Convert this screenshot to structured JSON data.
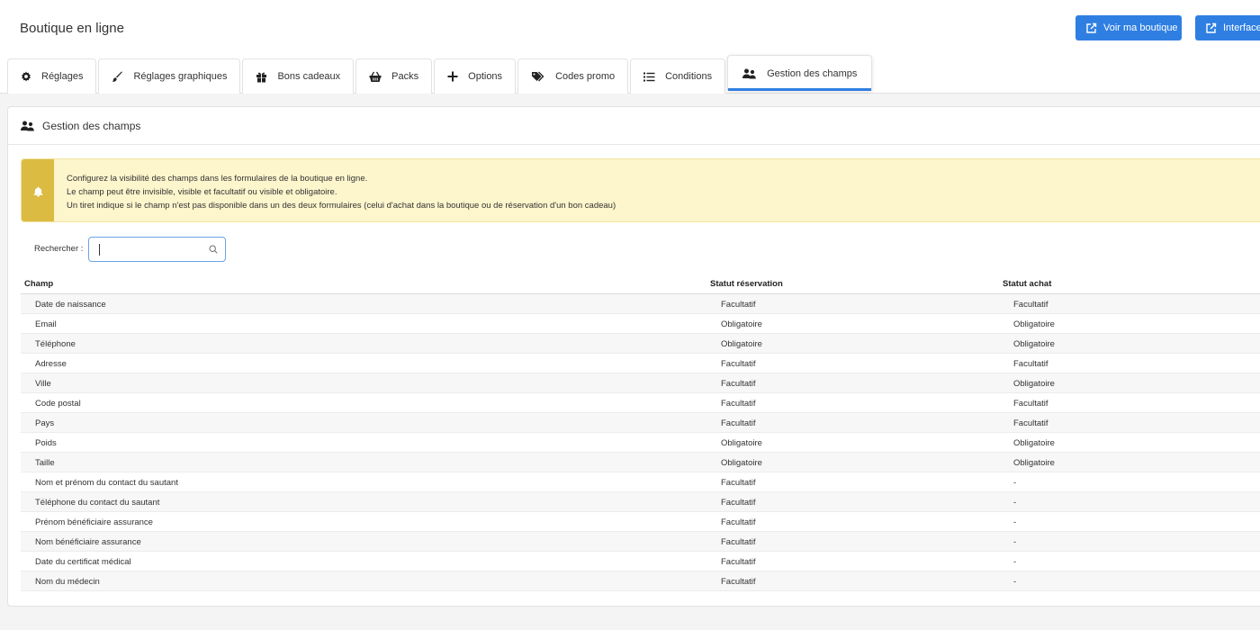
{
  "app": {
    "title": "Boutique en ligne"
  },
  "header": {
    "btn_shop": "Voir ma boutique",
    "btn_interface": "Interface"
  },
  "tabs": [
    {
      "label": "Réglages",
      "icon": "gear-icon"
    },
    {
      "label": "Réglages graphiques",
      "icon": "brush-icon"
    },
    {
      "label": "Bons cadeaux",
      "icon": "gift-icon"
    },
    {
      "label": "Packs",
      "icon": "basket-icon"
    },
    {
      "label": "Options",
      "icon": "plus-icon"
    },
    {
      "label": "Codes promo",
      "icon": "tags-icon"
    },
    {
      "label": "Conditions",
      "icon": "list-icon"
    },
    {
      "label": "Gestion des champs",
      "icon": "users-icon",
      "active": true
    }
  ],
  "panel": {
    "title": "Gestion des champs"
  },
  "alert": {
    "line1": "Configurez la visibilité des champs dans les formulaires de la boutique en ligne.",
    "line2": "Le champ peut être invisible, visible et facultatif ou visible et obligatoire.",
    "line3": "Un tiret indique si le champ n'est pas disponible dans un des deux formulaires (celui d'achat dans la boutique ou de réservation d'un bon cadeau)"
  },
  "search": {
    "label": "Rechercher :",
    "value": ""
  },
  "table": {
    "headers": [
      "Champ",
      "Statut réservation",
      "Statut achat"
    ],
    "rows": [
      [
        "Date de naissance",
        "Facultatif",
        "Facultatif"
      ],
      [
        "Email",
        "Obligatoire",
        "Obligatoire"
      ],
      [
        "Téléphone",
        "Obligatoire",
        "Obligatoire"
      ],
      [
        "Adresse",
        "Facultatif",
        "Facultatif"
      ],
      [
        "Ville",
        "Facultatif",
        "Obligatoire"
      ],
      [
        "Code postal",
        "Facultatif",
        "Facultatif"
      ],
      [
        "Pays",
        "Facultatif",
        "Facultatif"
      ],
      [
        "Poids",
        "Obligatoire",
        "Obligatoire"
      ],
      [
        "Taille",
        "Obligatoire",
        "Obligatoire"
      ],
      [
        "Nom et prénom du contact du sautant",
        "Facultatif",
        "-"
      ],
      [
        "Téléphone du contact du sautant",
        "Facultatif",
        "-"
      ],
      [
        "Prénom bénéficiaire assurance",
        "Facultatif",
        "-"
      ],
      [
        "Nom bénéficiaire assurance",
        "Facultatif",
        "-"
      ],
      [
        "Date du certificat médical",
        "Facultatif",
        "-"
      ],
      [
        "Nom du médecin",
        "Facultatif",
        "-"
      ]
    ]
  },
  "colors": {
    "accent": "#2f7fe2",
    "alert_bg": "#fdf5cc",
    "alert_side": "#dcbb43"
  }
}
